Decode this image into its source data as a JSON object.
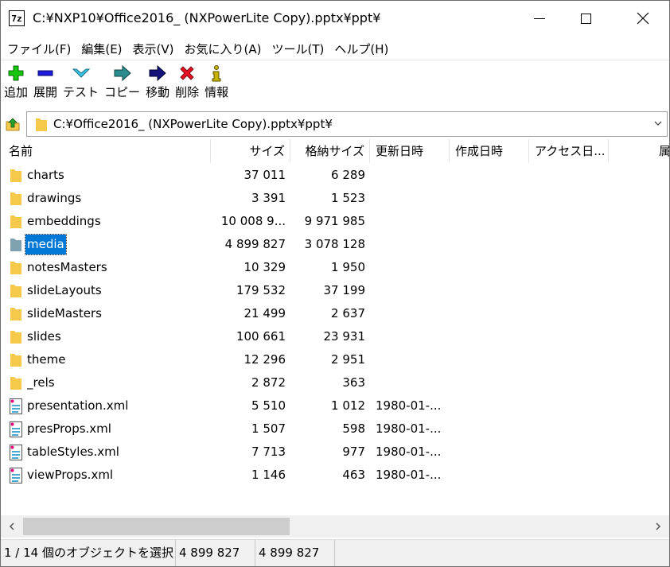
{
  "window": {
    "title": "C:¥NXP10¥Office2016_ (NXPowerLite Copy).pptx¥ppt¥",
    "app_icon_text": "7z"
  },
  "menu": [
    {
      "label": "ファイル(F)"
    },
    {
      "label": "編集(E)"
    },
    {
      "label": "表示(V)"
    },
    {
      "label": "お気に入り(A)"
    },
    {
      "label": "ツール(T)"
    },
    {
      "label": "ヘルプ(H)"
    }
  ],
  "toolbar": [
    {
      "label": "追加",
      "icon": "plus-icon",
      "color": "#16c60c"
    },
    {
      "label": "展開",
      "icon": "minus-icon",
      "color": "#1a1ad8"
    },
    {
      "label": "テスト",
      "icon": "check-icon",
      "color": "#3ec5e6"
    },
    {
      "label": "コピー",
      "icon": "copy-arrow-icon",
      "color": "#2a8c8c"
    },
    {
      "label": "移動",
      "icon": "move-arrow-icon",
      "color": "#13137a"
    },
    {
      "label": "削除",
      "icon": "delete-x-icon",
      "color": "#e81123"
    },
    {
      "label": "情報",
      "icon": "info-icon",
      "color": "#c8b400"
    }
  ],
  "address": {
    "path": "C:¥Office2016_ (NXPowerLite Copy).pptx¥ppt¥"
  },
  "columns": {
    "name": "名前",
    "size": "サイズ",
    "packed": "格納サイズ",
    "modified": "更新日時",
    "created": "作成日時",
    "accessed": "アクセス日...",
    "attr": "属"
  },
  "rows": [
    {
      "name": "charts",
      "size": "37 011",
      "packed": "6 289",
      "modified": "",
      "type": "folder"
    },
    {
      "name": "drawings",
      "size": "3 391",
      "packed": "1 523",
      "modified": "",
      "type": "folder"
    },
    {
      "name": "embeddings",
      "size": "10 008 9...",
      "packed": "9 971 985",
      "modified": "",
      "type": "folder"
    },
    {
      "name": "media",
      "size": "4 899 827",
      "packed": "3 078 128",
      "modified": "",
      "type": "folder",
      "selected": true
    },
    {
      "name": "notesMasters",
      "size": "10 329",
      "packed": "1 950",
      "modified": "",
      "type": "folder"
    },
    {
      "name": "slideLayouts",
      "size": "179 532",
      "packed": "37 199",
      "modified": "",
      "type": "folder"
    },
    {
      "name": "slideMasters",
      "size": "21 499",
      "packed": "2 637",
      "modified": "",
      "type": "folder"
    },
    {
      "name": "slides",
      "size": "100 661",
      "packed": "23 931",
      "modified": "",
      "type": "folder"
    },
    {
      "name": "theme",
      "size": "12 296",
      "packed": "2 951",
      "modified": "",
      "type": "folder"
    },
    {
      "name": "_rels",
      "size": "2 872",
      "packed": "363",
      "modified": "",
      "type": "folder"
    },
    {
      "name": "presentation.xml",
      "size": "5 510",
      "packed": "1 012",
      "modified": "1980-01-...",
      "type": "file"
    },
    {
      "name": "presProps.xml",
      "size": "1 507",
      "packed": "598",
      "modified": "1980-01-...",
      "type": "file"
    },
    {
      "name": "tableStyles.xml",
      "size": "7 713",
      "packed": "977",
      "modified": "1980-01-...",
      "type": "file"
    },
    {
      "name": "viewProps.xml",
      "size": "1 146",
      "packed": "463",
      "modified": "1980-01-...",
      "type": "file"
    }
  ],
  "status": {
    "selection": "1 / 14 個のオブジェクトを選択",
    "size": "4 899 827",
    "packed": "4 899 827"
  },
  "colors": {
    "folder": "#f7c94b",
    "folder_selected": "#7fa1b0",
    "selection": "#0078d7"
  }
}
